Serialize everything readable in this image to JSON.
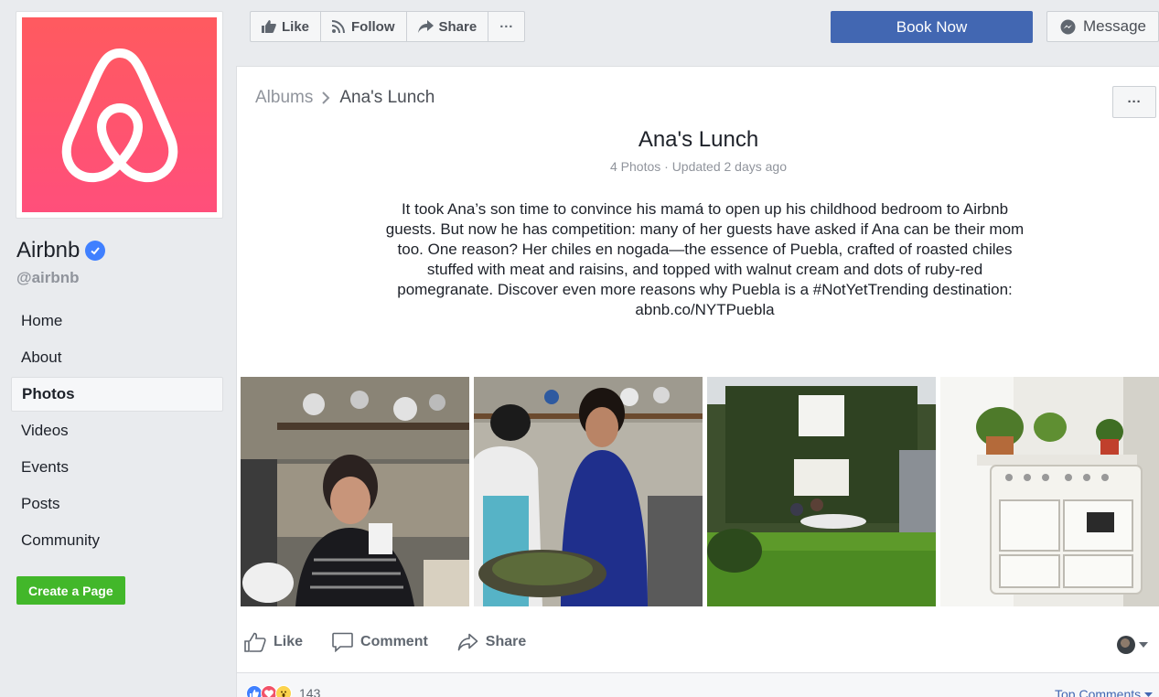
{
  "sidebar": {
    "page_name": "Airbnb",
    "handle": "@airbnb",
    "nav": [
      {
        "label": "Home"
      },
      {
        "label": "About"
      },
      {
        "label": "Photos",
        "active": true
      },
      {
        "label": "Videos"
      },
      {
        "label": "Events"
      },
      {
        "label": "Posts"
      },
      {
        "label": "Community"
      }
    ],
    "create_page_label": "Create a Page",
    "icons": [
      "airbnb-logo",
      "verified-badge-icon"
    ]
  },
  "topbar": {
    "like_label": "Like",
    "follow_label": "Follow",
    "share_label": "Share",
    "more_label": "···",
    "book_now_label": "Book Now",
    "message_label": "Message"
  },
  "album": {
    "breadcrumb_parent": "Albums",
    "breadcrumb_current": "Ana's Lunch",
    "title": "Ana's Lunch",
    "meta": "4 Photos · Updated 2 days ago",
    "description": "It took Ana’s son time to convince his mamá to open up his childhood bedroom to Airbnb guests. But now he has competition: many of her guests have asked if Ana can be their mom too. One reason? Her chiles en nogada—the essence of Puebla, crafted of roasted chiles stuffed with meat and raisins, and topped with walnut cream and dots of ruby-red pomegranate. Discover even more reasons why Puebla is a #NotYetTrending destination: abnb.co/NYTPuebla",
    "options_label": "···",
    "photos": [
      {
        "subject": "woman-laughing-with-cup"
      },
      {
        "subject": "two-women-cooking"
      },
      {
        "subject": "garden-house-courtyard"
      },
      {
        "subject": "vintage-white-stove"
      }
    ]
  },
  "actions": {
    "like_label": "Like",
    "comment_label": "Comment",
    "share_label": "Share"
  },
  "reactions": {
    "count": "143",
    "top_comments_label": "Top Comments"
  },
  "colors": {
    "brand_blue": "#4267b2",
    "airbnb_pink": "#ff5a5f",
    "create_green": "#42b72a",
    "background": "#e9ebee"
  }
}
